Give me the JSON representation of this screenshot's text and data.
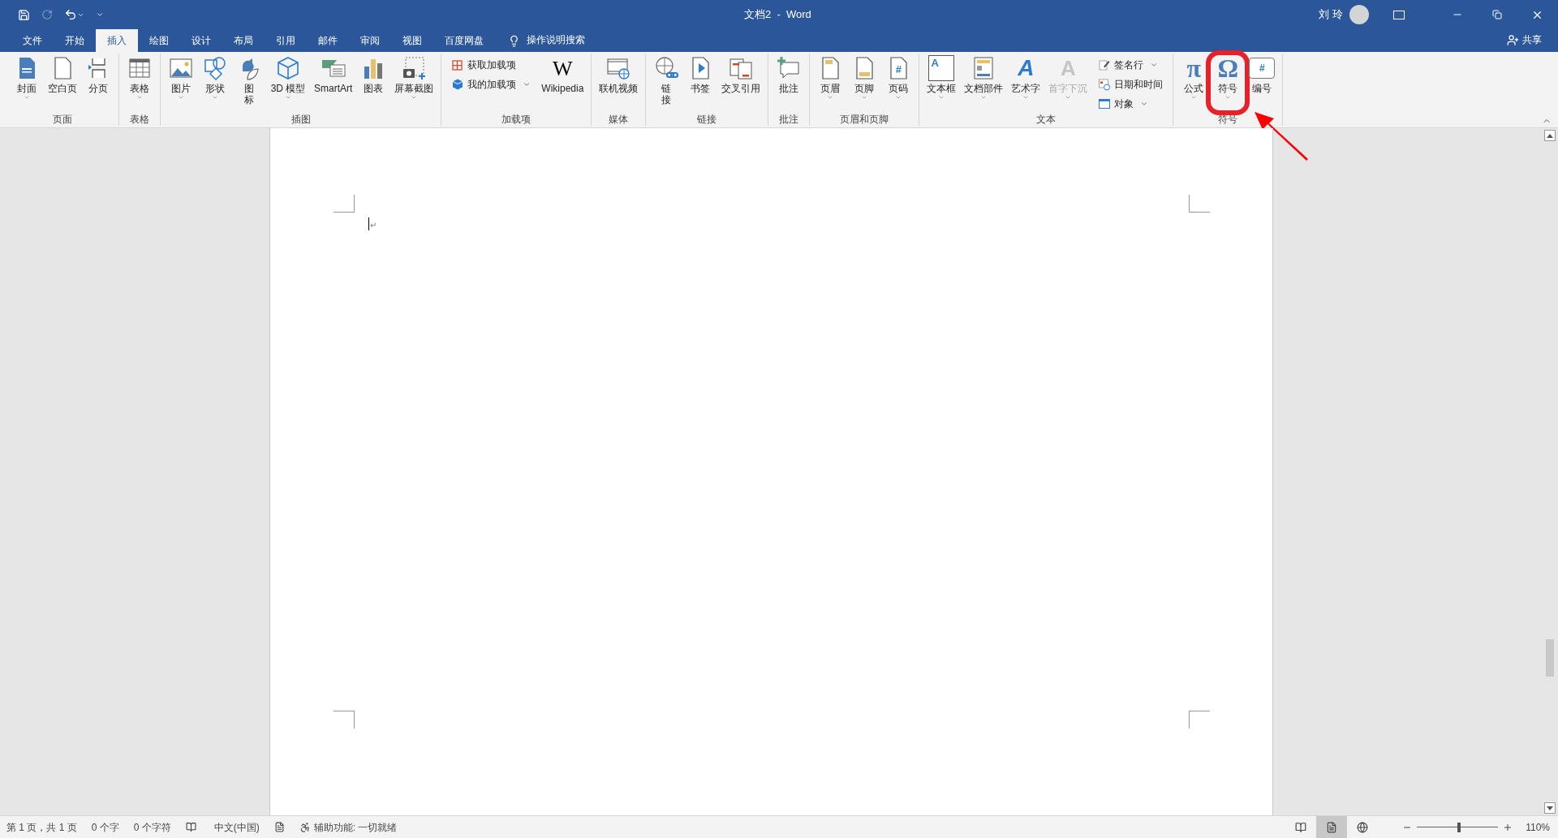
{
  "title_bar": {
    "title": "文档2  -  Word",
    "user": "刘 玲",
    "redo_disabled": true
  },
  "tabs": [
    {
      "label": "文件",
      "selected": false
    },
    {
      "label": "开始",
      "selected": false
    },
    {
      "label": "插入",
      "selected": true
    },
    {
      "label": "绘图",
      "selected": false
    },
    {
      "label": "设计",
      "selected": false
    },
    {
      "label": "布局",
      "selected": false
    },
    {
      "label": "引用",
      "selected": false
    },
    {
      "label": "邮件",
      "selected": false
    },
    {
      "label": "审阅",
      "selected": false
    },
    {
      "label": "视图",
      "selected": false
    },
    {
      "label": "百度网盘",
      "selected": false
    }
  ],
  "tell_me": "操作说明搜索",
  "share": "共享",
  "ribbon_groups": [
    {
      "label": "页面",
      "items": [
        {
          "kind": "large",
          "label": "封面",
          "caret": true,
          "disabled": false,
          "highlighted": false
        },
        {
          "kind": "large",
          "label": "空白页",
          "caret": false,
          "disabled": false,
          "highlighted": false
        },
        {
          "kind": "large",
          "label": "分页",
          "caret": false,
          "disabled": false,
          "highlighted": false
        }
      ]
    },
    {
      "label": "表格",
      "items": [
        {
          "kind": "large",
          "label": "表格",
          "caret": true,
          "disabled": false,
          "highlighted": false
        }
      ]
    },
    {
      "label": "插图",
      "items": [
        {
          "kind": "large",
          "label": "图片",
          "caret": true,
          "disabled": false,
          "highlighted": false
        },
        {
          "kind": "large",
          "label": "形状",
          "caret": true,
          "disabled": false,
          "highlighted": false
        },
        {
          "kind": "large",
          "label": "图标",
          "caret": false,
          "disabled": false,
          "highlighted": false
        },
        {
          "kind": "large",
          "label": "3D 模型",
          "caret": true,
          "disabled": false,
          "highlighted": false
        },
        {
          "kind": "large",
          "label": "SmartArt",
          "caret": false,
          "disabled": false,
          "highlighted": false
        },
        {
          "kind": "large",
          "label": "图表",
          "caret": false,
          "disabled": false,
          "highlighted": false
        },
        {
          "kind": "large",
          "label": "屏幕截图",
          "caret": true,
          "disabled": false,
          "highlighted": false
        }
      ]
    },
    {
      "label": "加载项",
      "items": [
        {
          "kind": "small",
          "label": "获取加载项",
          "caret": false,
          "disabled": false,
          "highlighted": false
        },
        {
          "kind": "small",
          "label": "我的加载项",
          "caret": true,
          "disabled": false,
          "highlighted": false
        },
        {
          "kind": "large",
          "label": "Wikipedia",
          "glyph": "W",
          "caret": false,
          "disabled": false,
          "highlighted": false
        }
      ]
    },
    {
      "label": "媒体",
      "items": [
        {
          "kind": "large",
          "label": "联机视频",
          "caret": false,
          "disabled": false,
          "highlighted": false
        }
      ]
    },
    {
      "label": "链接",
      "items": [
        {
          "kind": "large",
          "label": "链接",
          "caret": false,
          "disabled": false,
          "highlighted": false
        },
        {
          "kind": "large",
          "label": "书签",
          "caret": false,
          "disabled": false,
          "highlighted": false
        },
        {
          "kind": "large",
          "label": "交叉引用",
          "caret": false,
          "disabled": false,
          "highlighted": false
        }
      ]
    },
    {
      "label": "批注",
      "items": [
        {
          "kind": "large",
          "label": "批注",
          "caret": false,
          "disabled": false,
          "highlighted": false
        }
      ]
    },
    {
      "label": "页眉和页脚",
      "items": [
        {
          "kind": "large",
          "label": "页眉",
          "caret": true,
          "disabled": false,
          "highlighted": false
        },
        {
          "kind": "large",
          "label": "页脚",
          "caret": true,
          "disabled": false,
          "highlighted": false
        },
        {
          "kind": "large",
          "label": "页码",
          "glyph": "#",
          "caret": true,
          "disabled": false,
          "highlighted": false
        }
      ]
    },
    {
      "label": "文本",
      "items": [
        {
          "kind": "large",
          "label": "文本框",
          "glyph": "A",
          "caret": true,
          "disabled": false,
          "highlighted": false
        },
        {
          "kind": "large",
          "label": "文档部件",
          "caret": true,
          "disabled": false,
          "highlighted": false
        },
        {
          "kind": "large",
          "label": "艺术字",
          "glyph": "A",
          "caret": true,
          "disabled": false,
          "highlighted": false
        },
        {
          "kind": "large",
          "label": "首字下沉",
          "glyph": "A",
          "caret": true,
          "disabled": true,
          "highlighted": false
        },
        {
          "kind": "small",
          "label": "签名行",
          "caret": true,
          "disabled": false,
          "highlighted": false
        },
        {
          "kind": "small",
          "label": "日期和时间",
          "caret": false,
          "disabled": false,
          "highlighted": false
        },
        {
          "kind": "small",
          "label": "对象",
          "caret": true,
          "disabled": false,
          "highlighted": false
        }
      ]
    },
    {
      "label": "符号",
      "items": [
        {
          "kind": "large",
          "label": "公式",
          "glyph": "π",
          "caret": true,
          "disabled": false,
          "highlighted": false
        },
        {
          "kind": "large",
          "label": "符号",
          "glyph": "Ω",
          "caret": true,
          "disabled": false,
          "highlighted": true
        },
        {
          "kind": "large",
          "label": "编号",
          "glyph": "#",
          "caret": false,
          "disabled": false,
          "highlighted": false
        }
      ]
    }
  ],
  "document": {
    "paragraph_mark": "↵"
  },
  "status_bar": {
    "page": "第 1 页，共 1 页",
    "words": "0 个字",
    "chars": "0 个字符",
    "language": "中文(中国)",
    "accessibility": "辅助功能: 一切就绪",
    "views": [
      {
        "selected": false
      },
      {
        "selected": true
      },
      {
        "selected": false
      }
    ],
    "zoom": {
      "level": 0.52,
      "reading": "110%"
    }
  }
}
